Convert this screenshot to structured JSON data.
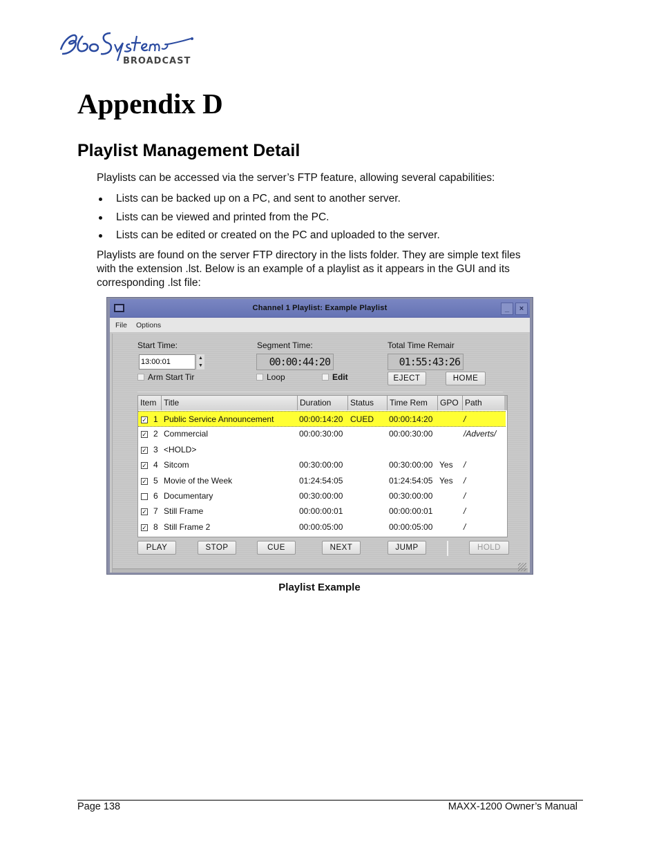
{
  "logo": {
    "brand": "360 Systems",
    "sub": "BROADCAST",
    "registered": "®",
    "color": "#2a4aa0"
  },
  "heading": "Appendix D",
  "section_title": "Playlist Management Detail",
  "intro": "Playlists can be accessed via the server’s FTP feature, allowing several capabilities:",
  "bullets": [
    "Lists can be backed up on a PC, and sent to another server.",
    "Lists can be viewed and printed from the PC.",
    "Lists can be edited or created on the PC and uploaded to the server."
  ],
  "paragraph2": "Playlists are found on the server FTP directory in the lists folder.  They are simple text files with the extension .lst.  Below is an example of a playlist as it appears in the GUI and its corresponding .lst file:",
  "window": {
    "title": "Channel  1 Playlist:  Example Playlist",
    "minimize_glyph": "_",
    "close_glyph": "×",
    "menu": [
      "File",
      "Options"
    ],
    "start_time_label": "Start Time:",
    "start_time_value": "13:00:01",
    "spin_up": "▲",
    "spin_down": "▼",
    "segment_time_label": "Segment Time:",
    "segment_time_value": "00:00:44:20",
    "total_time_label": "Total Time Remair",
    "total_time_value": "01:55:43:26",
    "arm_start_label": "Arm Start Tir",
    "loop_label": "Loop",
    "edit_label": "Edit",
    "eject_label": "EJECT",
    "home_label": "HOME",
    "columns": [
      "Item",
      "Title",
      "Duration",
      "Status",
      "Time Rem",
      "GPO",
      "Path"
    ],
    "rows": [
      {
        "checked": true,
        "item": "1",
        "title": "Public Service Announcement",
        "duration": "00:00:14:20",
        "status": "CUED",
        "time_rem": "00:00:14:20",
        "gpo": "",
        "path": "/",
        "selected": true
      },
      {
        "checked": true,
        "item": "2",
        "title": "Commercial",
        "duration": "00:00:30:00",
        "status": "",
        "time_rem": "00:00:30:00",
        "gpo": "",
        "path": "/Adverts/"
      },
      {
        "checked": true,
        "item": "3",
        "title": "<HOLD>",
        "duration": "",
        "status": "",
        "time_rem": "",
        "gpo": "",
        "path": ""
      },
      {
        "checked": true,
        "item": "4",
        "title": "Sitcom",
        "duration": "00:30:00:00",
        "status": "",
        "time_rem": "00:30:00:00",
        "gpo": "Yes",
        "path": "/"
      },
      {
        "checked": true,
        "item": "5",
        "title": "Movie of the Week",
        "duration": "01:24:54:05",
        "status": "",
        "time_rem": "01:24:54:05",
        "gpo": "Yes",
        "path": "/"
      },
      {
        "checked": false,
        "item": "6",
        "title": "Documentary",
        "duration": "00:30:00:00",
        "status": "",
        "time_rem": "00:30:00:00",
        "gpo": "",
        "path": "/"
      },
      {
        "checked": true,
        "item": "7",
        "title": "Still Frame",
        "duration": "00:00:00:01",
        "status": "",
        "time_rem": "00:00:00:01",
        "gpo": "",
        "path": "/"
      },
      {
        "checked": true,
        "item": "8",
        "title": "Still Frame 2",
        "duration": "00:00:05:00",
        "status": "",
        "time_rem": "00:00:05:00",
        "gpo": "",
        "path": "/"
      }
    ],
    "buttons": {
      "play": "PLAY",
      "stop": "STOP",
      "cue": "CUE",
      "next": "NEXT",
      "jump": "JUMP",
      "hold": "HOLD"
    },
    "highlight_color": "#ffff33",
    "titlebar_color": "#6d7bbb"
  },
  "caption": "Playlist Example",
  "footer": {
    "page": "Page 138",
    "manual": "MAXX-1200 Owner’s Manual"
  }
}
